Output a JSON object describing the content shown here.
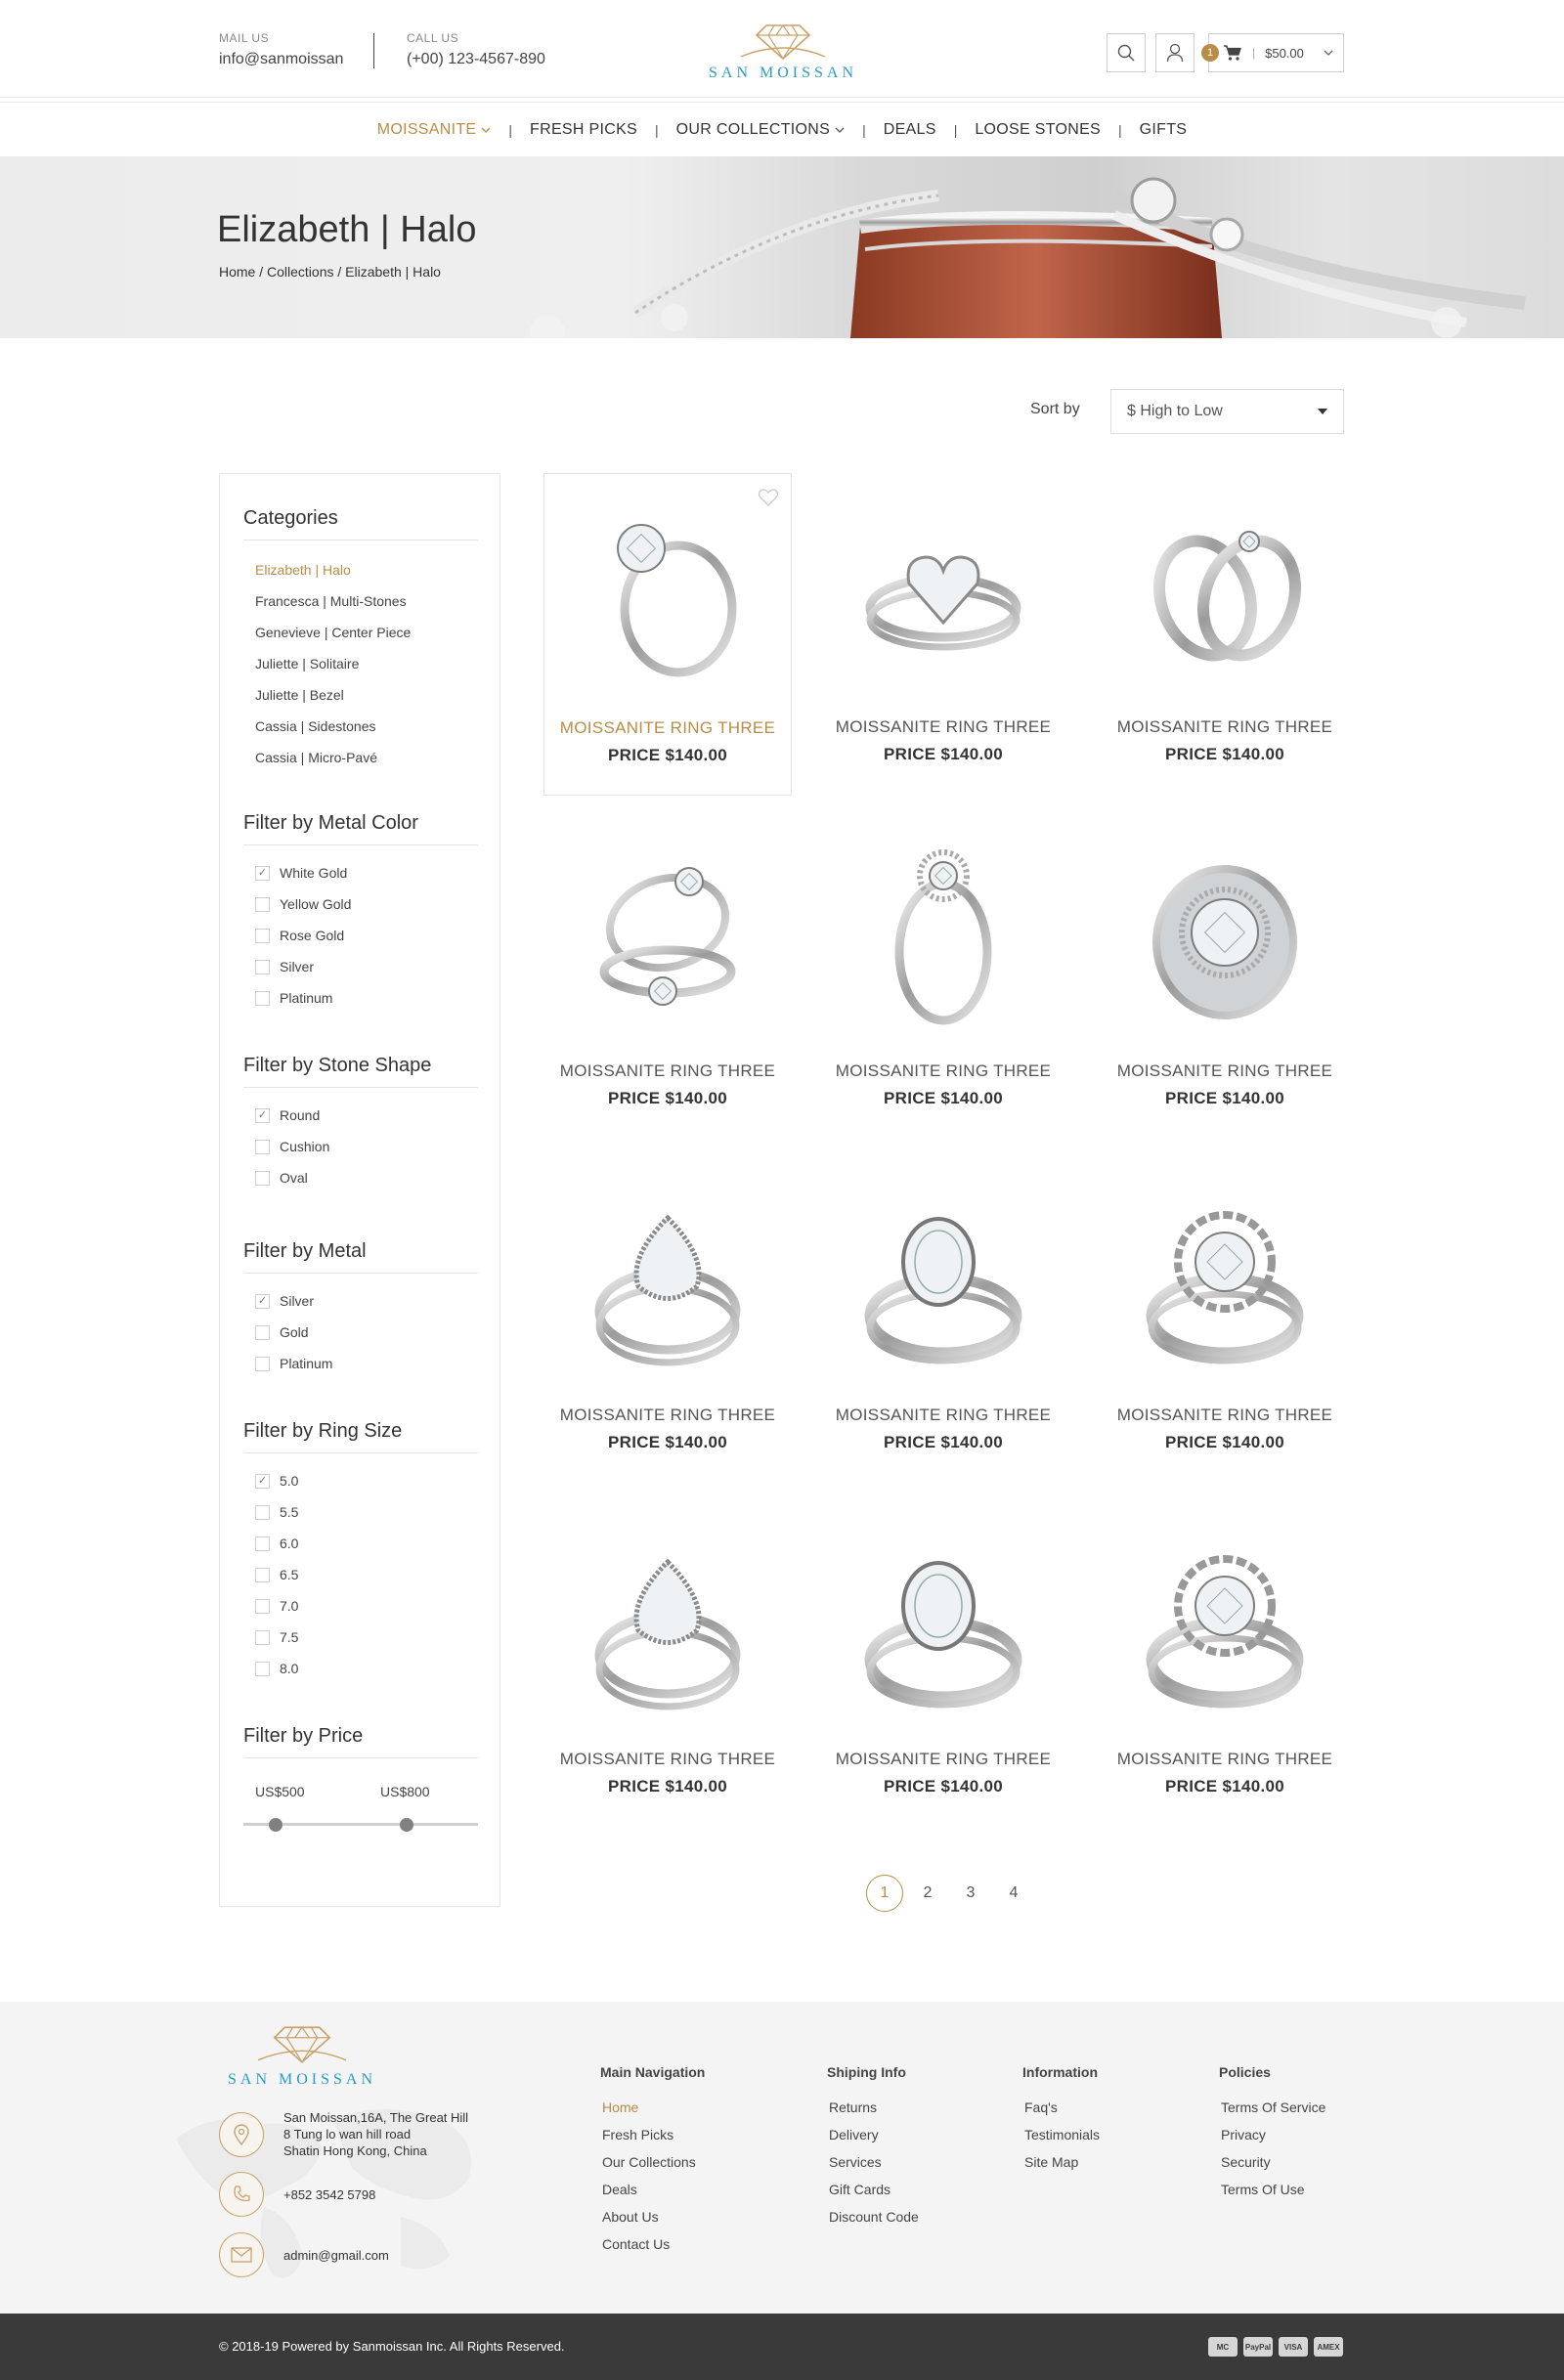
{
  "header": {
    "mail_label": "MAIL US",
    "mail_value": "info@sanmoissan",
    "call_label": "CALL US",
    "call_value": "(+00) 123-4567-890",
    "brand": "SAN MOISSAN",
    "cart_count": "1",
    "cart_amount": "$50.00"
  },
  "nav": {
    "items": [
      {
        "label": "MOISSANITE",
        "active": true,
        "dropdown": true
      },
      {
        "label": "FRESH PICKS"
      },
      {
        "label": "OUR COLLECTIONS",
        "dropdown": true
      },
      {
        "label": "DEALS"
      },
      {
        "label": "LOOSE STONES"
      },
      {
        "label": "GIFTS"
      }
    ]
  },
  "banner": {
    "title": "Elizabeth | Halo",
    "breadcrumb": "Home / Collections / Elizabeth | Halo"
  },
  "sort": {
    "label": "Sort by",
    "selected": "$ High to Low"
  },
  "sidebar": {
    "categories": {
      "title": "Categories",
      "items": [
        "Elizabeth | Halo",
        "Francesca | Multi-Stones",
        "Genevieve | Center Piece",
        "Juliette | Solitaire",
        "Juliette | Bezel",
        "Cassia | Sidestones",
        "Cassia | Micro-Pavé"
      ]
    },
    "metal_color": {
      "title": "Filter by Metal Color",
      "items": [
        "White Gold",
        "Yellow Gold",
        "Rose Gold",
        "Silver",
        "Platinum"
      ]
    },
    "stone_shape": {
      "title": "Filter by Stone Shape",
      "items": [
        "Round",
        "Cushion",
        "Oval"
      ]
    },
    "metal": {
      "title": "Filter by Metal",
      "items": [
        "Silver",
        "Gold",
        "Platinum"
      ]
    },
    "ring_size": {
      "title": "Filter by Ring Size",
      "items": [
        "5.0",
        "5.5",
        "6.0",
        "6.5",
        "7.0",
        "7.5",
        "8.0"
      ]
    },
    "price": {
      "title": "Filter by Price",
      "min": "US$500",
      "max": "US$800"
    }
  },
  "products": [
    {
      "name": "MOISSANITE RING THREE",
      "price": "PRICE $140.00",
      "image": "solitaire-ring"
    },
    {
      "name": "MOISSANITE RING THREE",
      "price": "PRICE $140.00",
      "image": "heart-halo-ring"
    },
    {
      "name": "MOISSANITE RING THREE",
      "price": "PRICE $140.00",
      "image": "couple-bands"
    },
    {
      "name": "MOISSANITE RING THREE",
      "price": "PRICE $140.00",
      "image": "bridal-set"
    },
    {
      "name": "MOISSANITE RING THREE",
      "price": "PRICE $140.00",
      "image": "crown-solitaire"
    },
    {
      "name": "MOISSANITE RING THREE",
      "price": "PRICE $140.00",
      "image": "round-halo-ring"
    },
    {
      "name": "MOISSANITE RING THREE",
      "price": "PRICE $140.00",
      "image": "pear-halo-ring"
    },
    {
      "name": "MOISSANITE RING THREE",
      "price": "PRICE $140.00",
      "image": "oval-halo-ring"
    },
    {
      "name": "MOISSANITE RING THREE",
      "price": "PRICE $140.00",
      "image": "flower-halo-ring"
    },
    {
      "name": "MOISSANITE RING THREE",
      "price": "PRICE $140.00",
      "image": "pear-halo-ring"
    },
    {
      "name": "MOISSANITE RING THREE",
      "price": "PRICE $140.00",
      "image": "oval-halo-ring"
    },
    {
      "name": "MOISSANITE RING THREE",
      "price": "PRICE $140.00",
      "image": "flower-halo-ring"
    }
  ],
  "pagination": {
    "pages": [
      "1",
      "2",
      "3",
      "4"
    ],
    "current": "1"
  },
  "footer": {
    "brand": "SAN MOISSAN",
    "address_lines": [
      "San Moissan,16A, The Great Hill",
      "8 Tung lo wan hill road",
      "Shatin Hong Kong, China"
    ],
    "phone": "+852 3542 5798",
    "email": "admin@gmail.com",
    "columns": [
      {
        "title": "Main Navigation",
        "items": [
          "Home",
          "Fresh Picks",
          "Our Collections",
          "Deals",
          "About Us",
          "Contact Us"
        ]
      },
      {
        "title": "Shiping Info",
        "items": [
          "Returns",
          "Delivery",
          "Services",
          "Gift Cards",
          "Discount Code"
        ]
      },
      {
        "title": "Information",
        "items": [
          "Faq's",
          "Testimonials",
          "Site Map"
        ]
      },
      {
        "title": "Policies",
        "items": [
          "Terms Of Service",
          "Privacy",
          "Security",
          "Terms Of Use"
        ]
      }
    ],
    "copyright": "© 2018-19 Powered by Sanmoissan Inc. All Rights Reserved.",
    "payments": [
      "MC",
      "PayPal",
      "VISA",
      "AMEX"
    ]
  },
  "colors": {
    "accent": "#b88d48",
    "brand_blue": "#2a9bc4",
    "footer_bg": "#f4f4f4",
    "bottom_bar": "#3a3a3a"
  }
}
